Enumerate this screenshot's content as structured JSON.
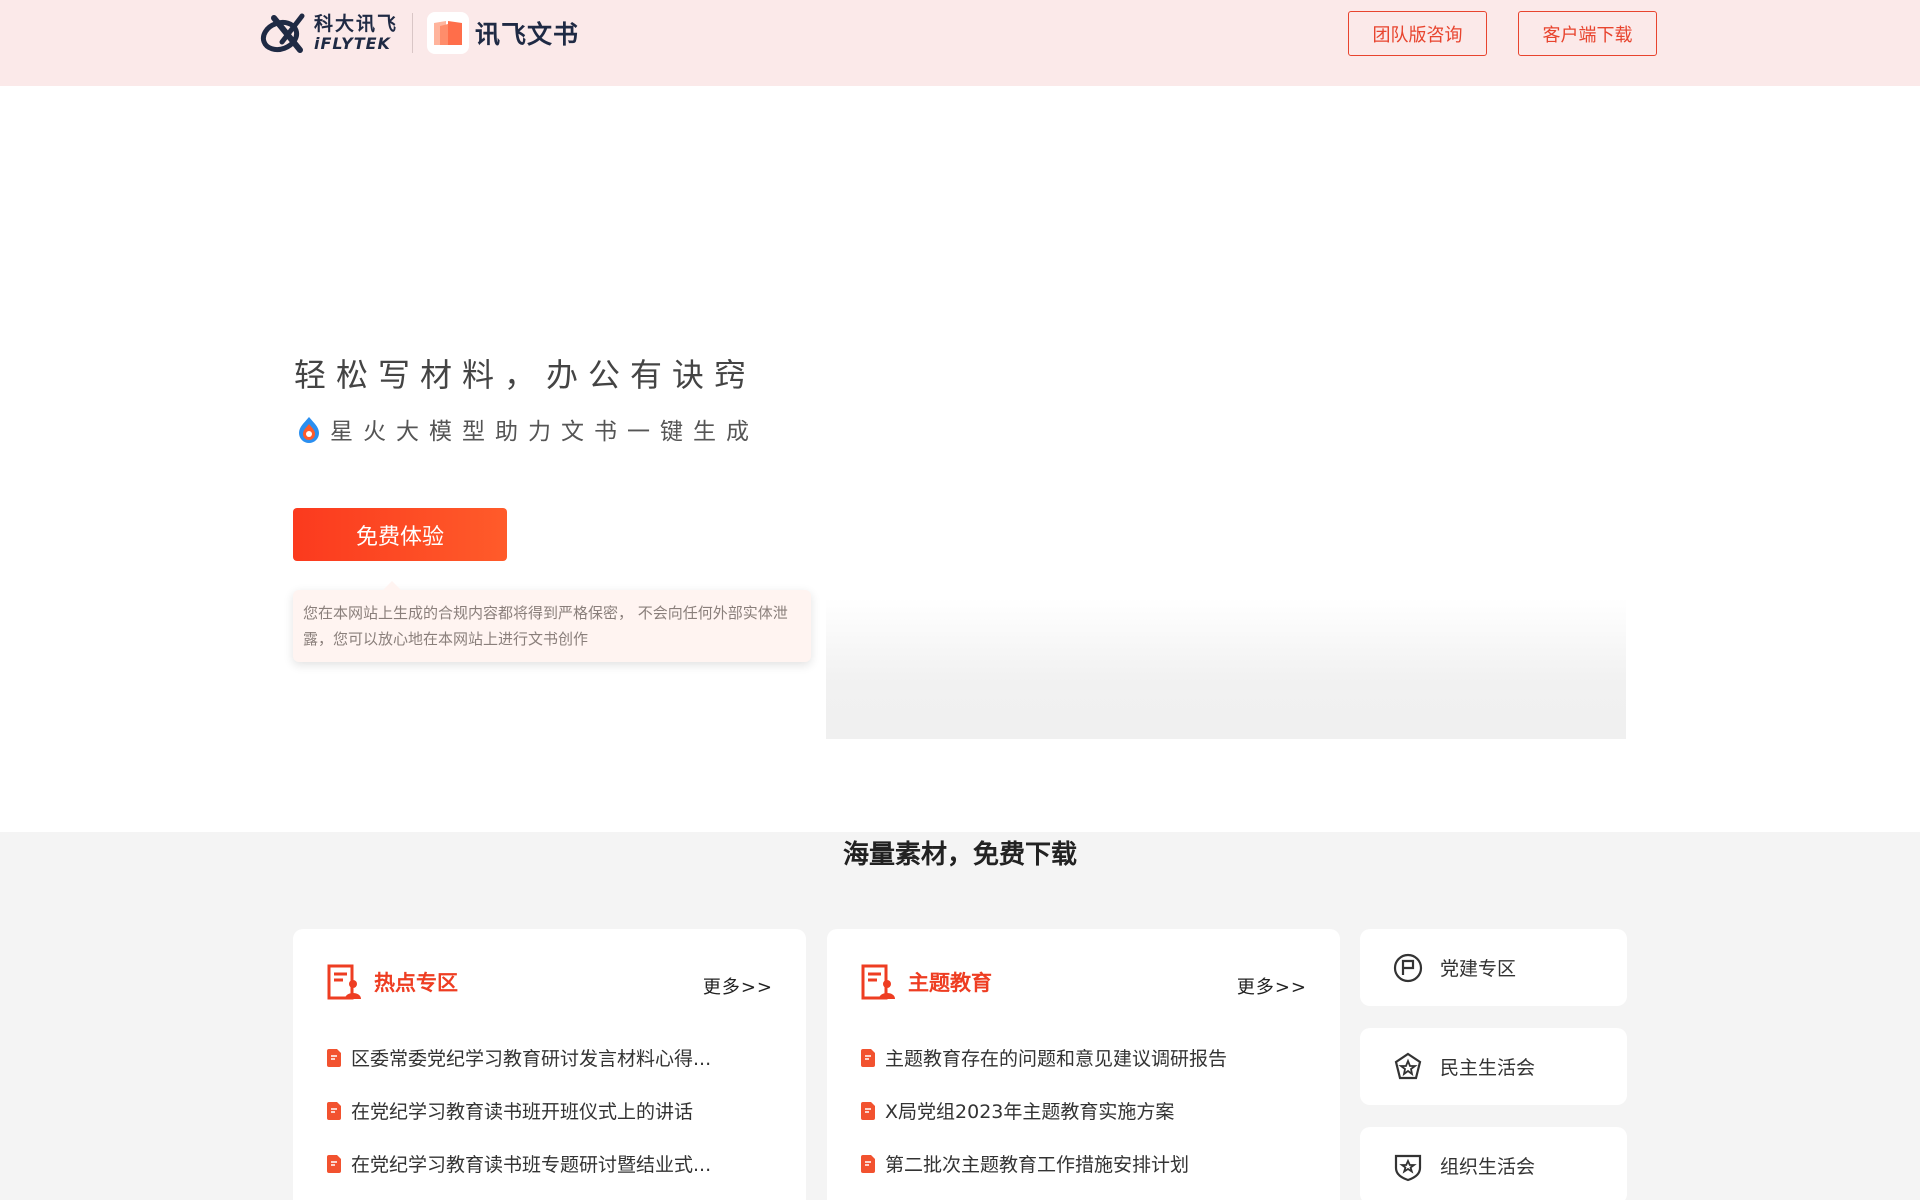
{
  "header": {
    "iflytek_cn": "科大讯飞",
    "iflytek_en": "iFLYTEK",
    "product_name": "讯飞文书",
    "team_button": "团队版咨询",
    "download_button": "客户端下载"
  },
  "hero": {
    "title": "轻松写材料，办公有诀窍",
    "subtitle": "星火大模型助力文书一键生成",
    "cta_button": "免费体验",
    "privacy_note": "您在本网站上生成的合规内容都将得到严格保密， 不会向任何外部实体泄露，您可以放心地在本网站上进行文书创作"
  },
  "materials": {
    "title": "海量素材，免费下载",
    "cards": [
      {
        "title": "热点专区",
        "more": "更多>>",
        "items": [
          "区委常委党纪学习教育研讨发言材料心得...",
          "在党纪学习教育读书班开班仪式上的讲话",
          "在党纪学习教育读书班专题研讨暨结业式..."
        ]
      },
      {
        "title": "主题教育",
        "more": "更多>>",
        "items": [
          "主题教育存在的问题和意见建议调研报告",
          "X局党组2023年主题教育实施方案",
          "第二批次主题教育工作措施安排计划"
        ]
      }
    ],
    "side": [
      {
        "label": "党建专区",
        "icon": "chat-flag-icon"
      },
      {
        "label": "民主生活会",
        "icon": "star-badge-icon"
      },
      {
        "label": "组织生活会",
        "icon": "shield-star-icon"
      }
    ]
  },
  "colors": {
    "accent": "#ee3d22",
    "header_bg": "#fbe9e9",
    "section_bg": "#f4f4f4"
  }
}
